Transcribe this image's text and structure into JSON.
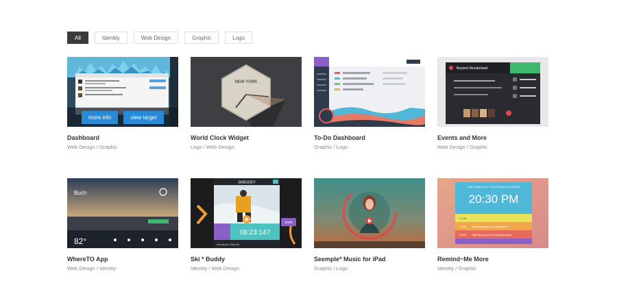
{
  "filters": [
    {
      "label": "All"
    },
    {
      "label": "Identity"
    },
    {
      "label": "Web Design"
    },
    {
      "label": "Graphic"
    },
    {
      "label": "Logo"
    }
  ],
  "overlay": {
    "more_info": "more info",
    "view_larger": "view larger"
  },
  "items": [
    {
      "title": "Dashboard",
      "categories": "Web Design / Graphic"
    },
    {
      "title": "World Clock Widget",
      "categories": "Logo / Web Design"
    },
    {
      "title": "To-Do Dashboard",
      "categories": "Graphic / Logo"
    },
    {
      "title": "Events and More",
      "categories": "Web Design / Graphic"
    },
    {
      "title": "WhereTO App",
      "categories": "Web Design / Identity"
    },
    {
      "title": "Ski * Buddy",
      "categories": "Identity / Web Design"
    },
    {
      "title": "Seemple* Music for iPad",
      "categories": "Graphic / Logo"
    },
    {
      "title": "Remind~Me More",
      "categories": "Identity / Graphic"
    }
  ],
  "thumbnails": {
    "clock_city": "NEW YORK",
    "events_title": "Beyond Wonderland",
    "whereto_city": "Buch",
    "whereto_temp": "82°",
    "ski_header": "SKIBUDDY",
    "ski_time": "08:23:147",
    "ski_name": "Alexandre Gilberto",
    "remind_time": "20:30 PM",
    "remind_header": "TAKE BIANCA OUT FOR A ROMANTIC DINNER",
    "remind_rows": [
      "12:30",
      "13:00",
      "15:00"
    ],
    "remind_items": [
      "Holiday shopping & Christmas tree",
      "Take Bianca out for a Romantic dinner"
    ],
    "ski_speed": "km/h"
  }
}
